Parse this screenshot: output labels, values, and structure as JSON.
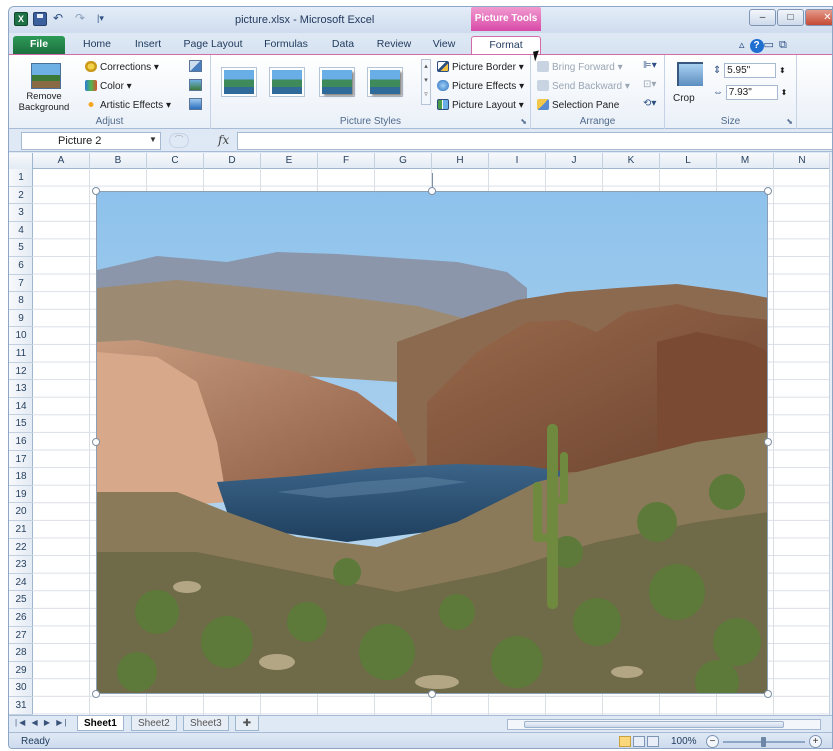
{
  "title_bar": {
    "title": "picture.xlsx - Microsoft Excel",
    "contextual_tab_label": "Picture Tools",
    "app_icon_letter": "X",
    "undo_glyph": "↶",
    "redo_glyph": "↷",
    "customize_glyph": "|▾"
  },
  "window_controls": {
    "minimize": "–",
    "maximize": "□",
    "close": "✕"
  },
  "tabs": [
    "File",
    "Home",
    "Insert",
    "Page Layout",
    "Formulas",
    "Data",
    "Review",
    "View",
    "Format"
  ],
  "active_tab": "Format",
  "ribbon": {
    "adjust": {
      "remove_background": "Remove\nBackground",
      "corrections": "Corrections",
      "color": "Color",
      "artistic_effects": "Artistic Effects",
      "label": "Adjust"
    },
    "picture_styles": {
      "picture_border": "Picture Border",
      "picture_effects": "Picture Effects",
      "picture_layout": "Picture Layout",
      "label": "Picture Styles"
    },
    "arrange": {
      "bring_forward": "Bring Forward",
      "send_backward": "Send Backward",
      "selection_pane": "Selection Pane",
      "label": "Arrange"
    },
    "size": {
      "crop": "Crop",
      "height": "5.95\"",
      "width": "7.93\"",
      "label": "Size"
    }
  },
  "formula_bar": {
    "name_box": "Picture 2",
    "fx": "fx",
    "formula": ""
  },
  "columns": [
    "A",
    "B",
    "C",
    "D",
    "E",
    "F",
    "G",
    "H",
    "I",
    "J",
    "K",
    "L",
    "M",
    "N"
  ],
  "rows": [
    "1",
    "2",
    "3",
    "4",
    "5",
    "6",
    "7",
    "8",
    "9",
    "10",
    "11",
    "12",
    "13",
    "14",
    "15",
    "16",
    "17",
    "18",
    "19",
    "20",
    "21",
    "22",
    "23",
    "24",
    "25",
    "26",
    "27",
    "28",
    "29",
    "30",
    "31"
  ],
  "sheets": [
    "Sheet1",
    "Sheet2",
    "Sheet3"
  ],
  "active_sheet": "Sheet1",
  "status": {
    "text": "Ready",
    "zoom": "100%"
  },
  "colors": {
    "excel_green": "#1e7145",
    "picture_tools_pink": "#d94aa8",
    "ribbon_blue": "#dfe9f5"
  },
  "picture_description_icon": "landscape-photo"
}
